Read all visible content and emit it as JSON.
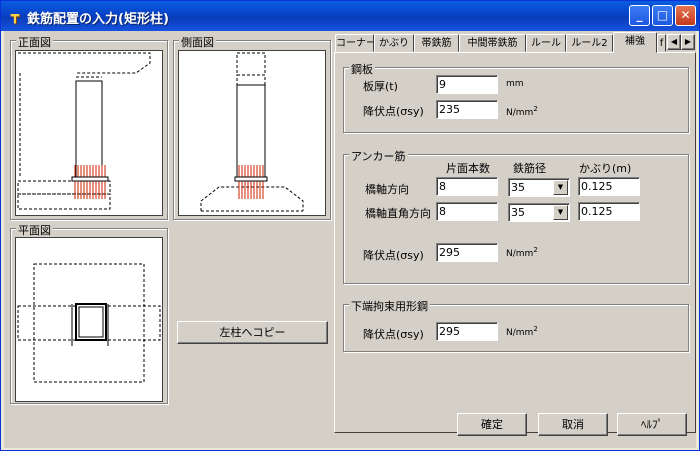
{
  "window": {
    "title": "鉄筋配置の入力(矩形柱)",
    "icon": "rebar-app-icon"
  },
  "titlebar_buttons": {
    "minimize": "_",
    "maximize": "□",
    "close": "✕"
  },
  "views": {
    "front": "正面図",
    "side": "側面図",
    "plan": "平面図"
  },
  "copy_button": "左柱へコピー",
  "tabs": [
    "コーナー",
    "かぶり",
    "帯鉄筋",
    "中間帯鉄筋",
    "ルール",
    "ルール2",
    "補強",
    "f"
  ],
  "active_tab": "補強",
  "tab_scroll": {
    "left": "◀",
    "right": "▶"
  },
  "steel_plate": {
    "title": "鋼板",
    "thickness_label": "板厚(t)",
    "thickness_value": "9",
    "thickness_unit": "mm",
    "yield_label": "降伏点(σsy)",
    "yield_value": "235",
    "yield_unit": "N/mm",
    "unit_exp": "2"
  },
  "anchor": {
    "title": "アンカー筋",
    "col_count": "片面本数",
    "col_diameter": "鉄筋径",
    "col_cover": "かぶり(m)",
    "rows": [
      {
        "label": "橋軸方向",
        "count": "8",
        "diameter": "35",
        "cover": "0.125"
      },
      {
        "label": "橋軸直角方向",
        "count": "8",
        "diameter": "35",
        "cover": "0.125"
      }
    ],
    "yield_label": "降伏点(σsy)",
    "yield_value": "295",
    "yield_unit": "N/mm",
    "unit_exp": "2"
  },
  "bottom_steel": {
    "title": "下端拘束用形鋼",
    "yield_label": "降伏点(σsy)",
    "yield_value": "295",
    "yield_unit": "N/mm",
    "unit_exp": "2"
  },
  "buttons": {
    "ok": "確定",
    "cancel": "取消",
    "help": "ﾍﾙﾌﾟ"
  },
  "colors": {
    "rebar": "#cc2200",
    "title_bar": "#0a5de0"
  }
}
